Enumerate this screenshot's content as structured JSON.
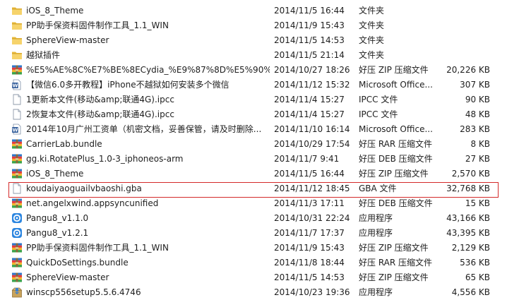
{
  "files": [
    {
      "name": "iOS_8_Theme",
      "date": "2014/11/5 16:44",
      "type": "文件夹",
      "size": "",
      "icon": "folder-icon"
    },
    {
      "name": "PP助手保资料固件制作工具_1.1_WIN",
      "date": "2014/11/9 15:43",
      "type": "文件夹",
      "size": "",
      "icon": "folder-icon"
    },
    {
      "name": "SphereView-master",
      "date": "2014/11/5 14:53",
      "type": "文件夹",
      "size": "",
      "icon": "folder-icon"
    },
    {
      "name": "越狱插件",
      "date": "2014/11/5 21:14",
      "type": "文件夹",
      "size": "",
      "icon": "folder-icon"
    },
    {
      "name": "%E5%AE%8C%E7%BE%8ECydia_%E9%87%8D%E5%90%...",
      "date": "2014/10/27 18:26",
      "type": "好压 ZIP 压缩文件",
      "size": "20,226 KB",
      "icon": "archive-icon"
    },
    {
      "name": "【微信6.0多开教程】iPhone不越狱如何安装多个微信",
      "date": "2014/11/12 15:32",
      "type": "Microsoft Office...",
      "size": "307 KB",
      "icon": "word-doc-icon"
    },
    {
      "name": "1更新本文件(移动&amp;联通4G).ipcc",
      "date": "2014/11/4 15:27",
      "type": "IPCC 文件",
      "size": "90 KB",
      "icon": "file-icon"
    },
    {
      "name": "2恢复本文件(移动&amp;联通4G).ipcc",
      "date": "2014/11/4 15:27",
      "type": "IPCC 文件",
      "size": "48 KB",
      "icon": "file-icon"
    },
    {
      "name": "2014年10月广州工资单（机密文档，妥善保管，请及时删除...",
      "date": "2014/11/10 16:14",
      "type": "Microsoft Office...",
      "size": "283 KB",
      "icon": "word-doc-icon"
    },
    {
      "name": "CarrierLab.bundle",
      "date": "2014/10/29 17:54",
      "type": "好压 RAR 压缩文件",
      "size": "8 KB",
      "icon": "archive-icon"
    },
    {
      "name": "gg.ki.RotatePlus_1.0-3_iphoneos-arm",
      "date": "2014/11/7 9:41",
      "type": "好压 DEB 压缩文件",
      "size": "27 KB",
      "icon": "archive-icon"
    },
    {
      "name": "iOS_8_Theme",
      "date": "2014/11/5 16:44",
      "type": "好压 ZIP 压缩文件",
      "size": "2,570 KB",
      "icon": "archive-icon"
    },
    {
      "name": "koudaiyaoguailvbaoshi.gba",
      "date": "2014/11/12 18:45",
      "type": "GBA 文件",
      "size": "32,768 KB",
      "icon": "file-icon"
    },
    {
      "name": "net.angelxwind.appsyncunified",
      "date": "2014/11/3 17:11",
      "type": "好压 DEB 压缩文件",
      "size": "15 KB",
      "icon": "archive-icon"
    },
    {
      "name": "Pangu8_v1.1.0",
      "date": "2014/10/31 22:24",
      "type": "应用程序",
      "size": "43,166 KB",
      "icon": "app-icon"
    },
    {
      "name": "Pangu8_v1.2.1",
      "date": "2014/11/7 17:37",
      "type": "应用程序",
      "size": "43,395 KB",
      "icon": "app-icon"
    },
    {
      "name": "PP助手保资料固件制作工具_1.1_WIN",
      "date": "2014/11/9 15:43",
      "type": "好压 ZIP 压缩文件",
      "size": "2,129 KB",
      "icon": "archive-icon"
    },
    {
      "name": "QuickDoSettings.bundle",
      "date": "2014/11/8 18:44",
      "type": "好压 RAR 压缩文件",
      "size": "536 KB",
      "icon": "archive-icon"
    },
    {
      "name": "SphereView-master",
      "date": "2014/11/5 14:53",
      "type": "好压 ZIP 压缩文件",
      "size": "65 KB",
      "icon": "archive-icon"
    },
    {
      "name": "winscp556setup5.5.6.4746",
      "date": "2014/10/23 19:36",
      "type": "应用程序",
      "size": "4,556 KB",
      "icon": "installer-icon"
    }
  ],
  "highlighted_row": 12
}
